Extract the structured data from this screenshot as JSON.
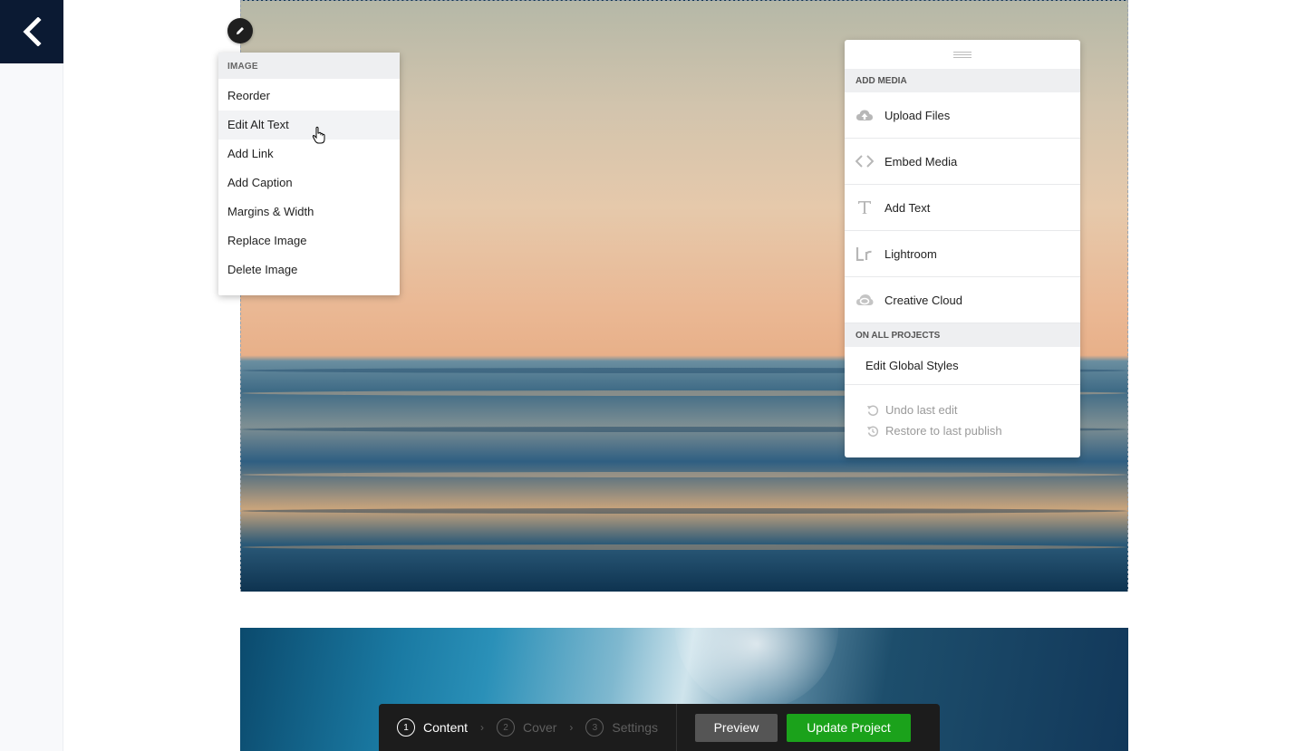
{
  "nav": {
    "back_icon": "chevron-left-icon"
  },
  "image_menu": {
    "header": "IMAGE",
    "items": [
      {
        "label": "Reorder"
      },
      {
        "label": "Edit Alt Text"
      },
      {
        "label": "Add Link"
      },
      {
        "label": "Add Caption"
      },
      {
        "label": "Margins & Width"
      },
      {
        "label": "Replace Image"
      },
      {
        "label": "Delete Image"
      }
    ]
  },
  "media_panel": {
    "add_media_header": "ADD MEDIA",
    "items": [
      {
        "label": "Upload Files",
        "icon": "cloud-upload-icon"
      },
      {
        "label": "Embed Media",
        "icon": "code-brackets-icon"
      },
      {
        "label": "Add Text",
        "icon": "text-t-icon"
      },
      {
        "label": "Lightroom",
        "icon": "lightroom-icon"
      },
      {
        "label": "Creative Cloud",
        "icon": "creative-cloud-icon"
      }
    ],
    "all_projects_header": "ON ALL PROJECTS",
    "global_styles": "Edit Global Styles",
    "undo": "Undo last edit",
    "restore": "Restore to last publish"
  },
  "bottom_bar": {
    "steps": [
      {
        "num": "1",
        "label": "Content"
      },
      {
        "num": "2",
        "label": "Cover"
      },
      {
        "num": "3",
        "label": "Settings"
      }
    ],
    "preview": "Preview",
    "update": "Update Project"
  },
  "colors": {
    "nav_dark": "#0b1a33",
    "accent_green": "#1ba21b",
    "bar_dark": "#1c1c1c"
  }
}
